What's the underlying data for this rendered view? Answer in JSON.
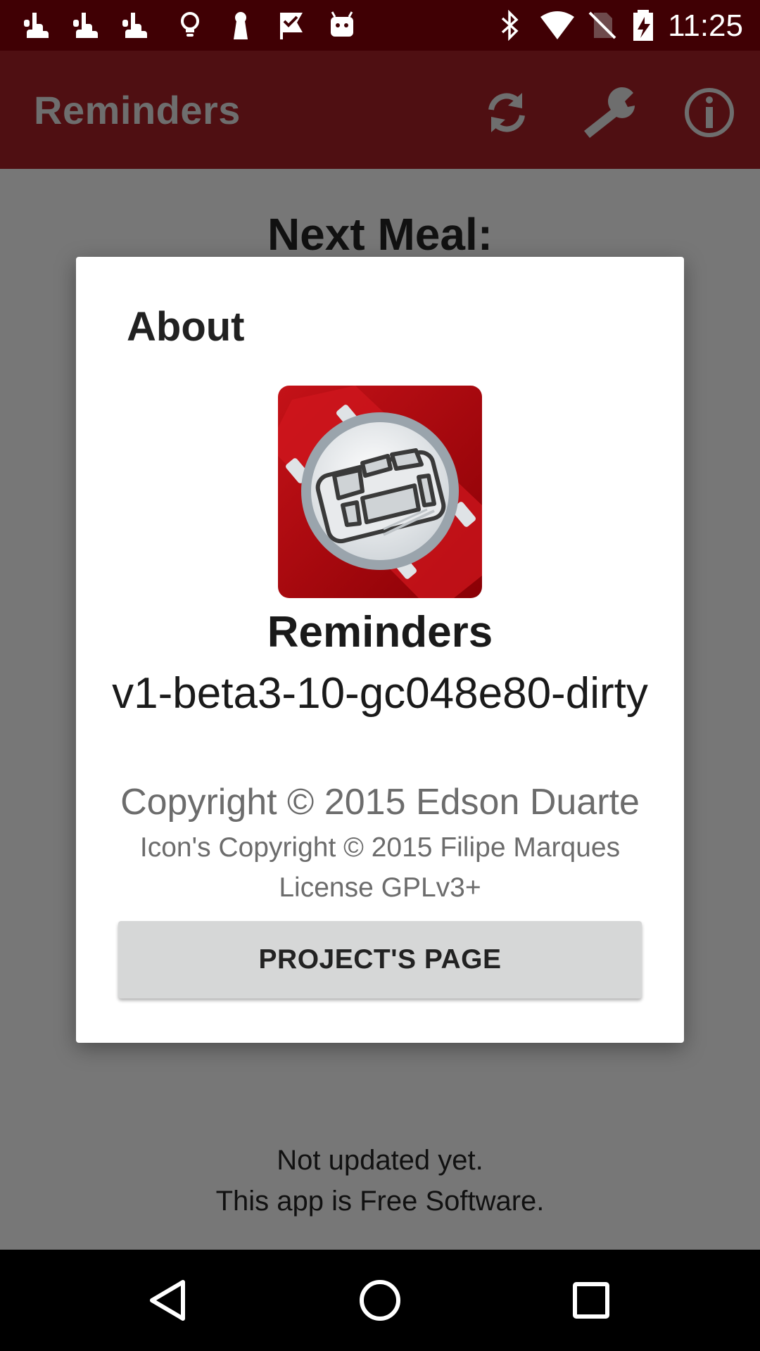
{
  "status_bar": {
    "time": "11:25",
    "left_icons": [
      "hand-pointer-icon",
      "hand-pointer-icon",
      "hand-pointer-icon",
      "lightbulb-icon",
      "keyhole-icon",
      "check-flag-icon",
      "android-robot-icon"
    ],
    "right_icons": [
      "bluetooth-icon",
      "wifi-icon",
      "no-sim-icon",
      "battery-charging-icon"
    ]
  },
  "toolbar": {
    "title": "Reminders",
    "actions": [
      "refresh-icon",
      "wrench-icon",
      "info-icon"
    ],
    "color": "#4f0f12"
  },
  "main": {
    "heading": "Next Meal:",
    "status_line": "Not updated yet.",
    "free_software_line": "This app is Free Software."
  },
  "dialog": {
    "title": "About",
    "app_name": "Reminders",
    "version": "v1-beta3-10-gc048e80-dirty",
    "copyright": "Copyright © 2015 Edson Duarte",
    "icon_copyright": "Icon's Copyright © 2015 Filipe Marques",
    "license": "License GPLv3+",
    "project_button": "PROJECT'S PAGE",
    "logo_color": "#b30a0f"
  },
  "nav_bar": {
    "buttons": [
      "back-icon",
      "home-icon",
      "recents-icon"
    ]
  }
}
